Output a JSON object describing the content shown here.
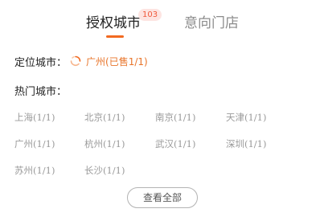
{
  "tabs": {
    "authorized_label": "授权城市",
    "authorized_count": "103",
    "intended_label": "意向门店"
  },
  "located": {
    "label": "定位城市：",
    "city": "广州(已售1/1)",
    "icon": "loading-refresh-icon",
    "accent_color": "#f26a21"
  },
  "hot": {
    "label": "热门城市：",
    "cities": [
      "上海(1/1)",
      "北京(1/1)",
      "南京(1/1)",
      "天津(1/1)",
      "广州(1/1)",
      "杭州(1/1)",
      "武汉(1/1)",
      "深圳(1/1)",
      "苏州(1/1)",
      "长沙(1/1)"
    ]
  },
  "view_all_label": "查看全部"
}
